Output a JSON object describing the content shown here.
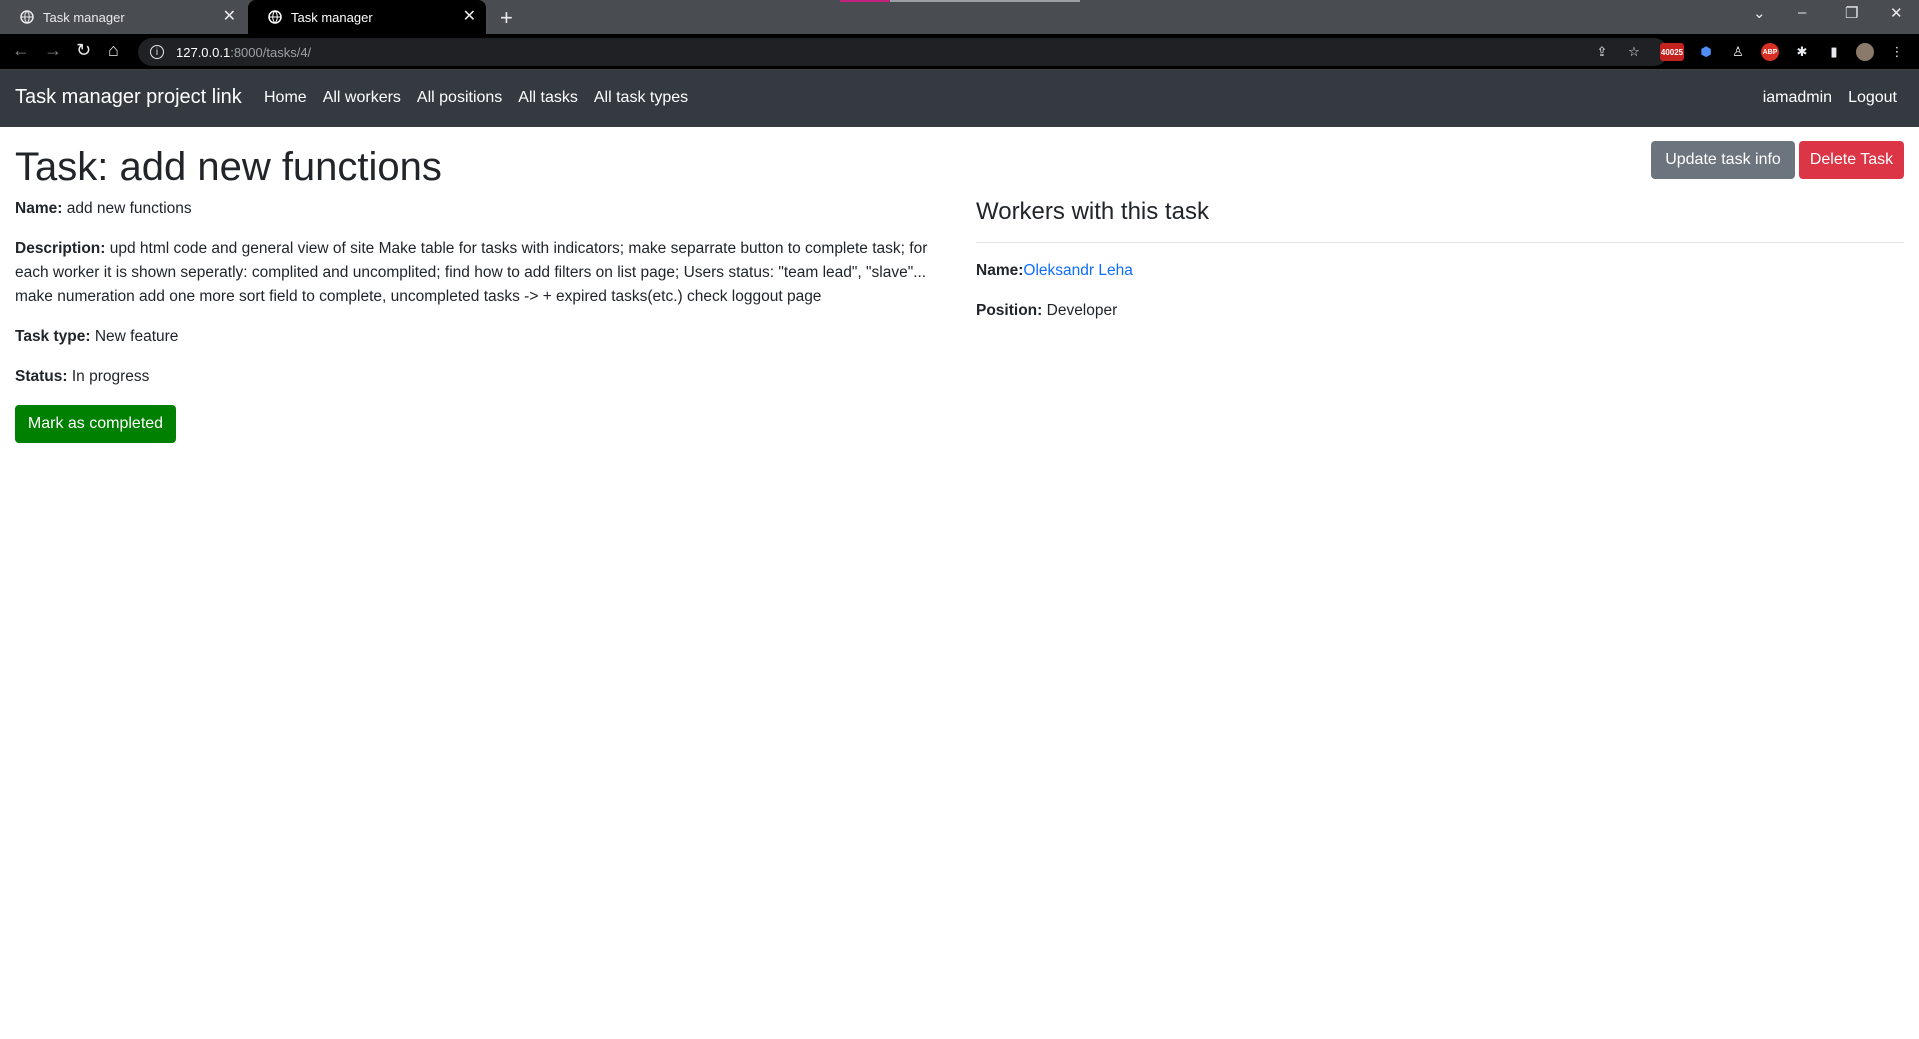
{
  "browser": {
    "tabs": [
      {
        "title": "Task manager",
        "active": false
      },
      {
        "title": "Task manager",
        "active": true
      }
    ],
    "url_host": "127.0.0.1",
    "url_path": ":8000/tasks/4/",
    "extension_badge": "40025",
    "extension_abp": "ABP"
  },
  "navbar": {
    "brand": "Task manager project link",
    "links": [
      "Home",
      "All workers",
      "All positions",
      "All tasks",
      "All task types"
    ],
    "user": "iamadmin",
    "logout": "Logout"
  },
  "task": {
    "page_title": "Task: add new functions",
    "name_label": "Name:",
    "name": "add new functions",
    "description_label": "Description:",
    "description": "upd html code and general view of site Make table for tasks with indicators; make separrate button to complete task; for each worker it is shown seperatly: complited and uncomplited; find how to add filters on list page; Users status: \"team lead\", \"slave\"... make numeration add one more sort field to complete, uncompleted tasks -> + expired tasks(etc.) check loggout page",
    "type_label": "Task type:",
    "type": "New feature",
    "status_label": "Status:",
    "status": "In progress",
    "complete_button": "Mark as completed",
    "update_button": "Update task info",
    "delete_button": "Delete Task"
  },
  "workers": {
    "heading": "Workers with this task",
    "name_label": "Name:",
    "name": "Oleksandr Leha",
    "position_label": "Position:",
    "position": "Developer"
  },
  "colors": {
    "navbar_bg": "#343a40",
    "update_btn": "#6c757d",
    "delete_btn": "#dc3545",
    "complete_btn": "#008000",
    "link": "#0d6efd"
  }
}
